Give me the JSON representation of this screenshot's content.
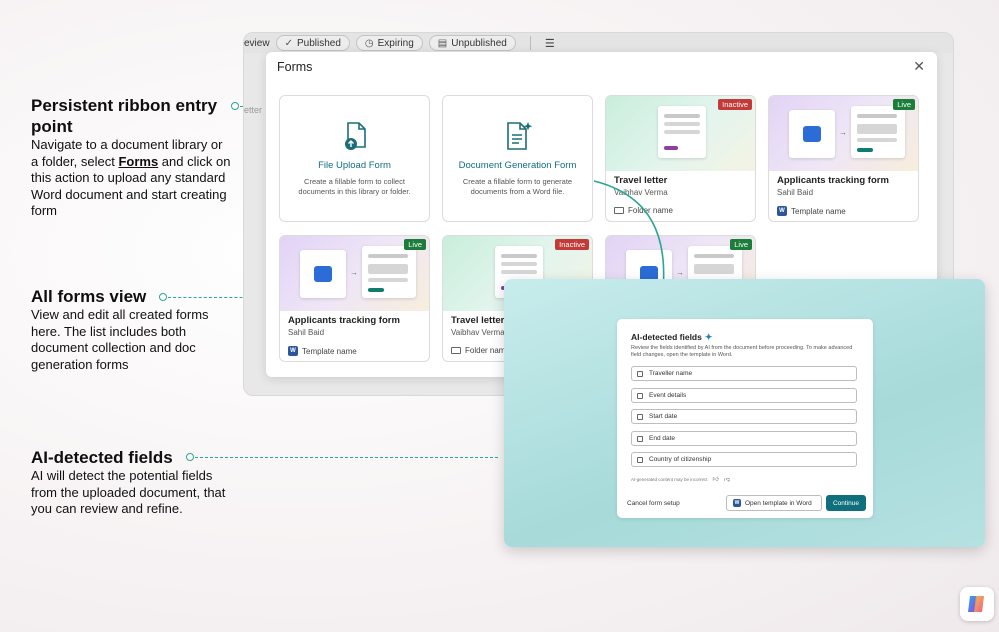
{
  "annotations": [
    {
      "title": "Persistent ribbon entry point",
      "body_before": "Navigate to a document library or a folder, select ",
      "body_bold": "Forms",
      "body_after": " and click on this action to upload any standard Word document and start creating form"
    },
    {
      "title": "All forms view",
      "body": "View and edit all created forms here. The list includes both document collection and doc generation forms"
    },
    {
      "title": "AI-detected fields",
      "body": "AI will detect the potential fields from the uploaded document, that you can review and refine."
    }
  ],
  "background_window": {
    "tabs": [
      {
        "label": "eview",
        "icon": ""
      },
      {
        "label": "Published",
        "icon": "check-circle-icon"
      },
      {
        "label": "Expiring",
        "icon": "clock-icon"
      },
      {
        "label": "Unpublished",
        "icon": "archive-icon"
      }
    ],
    "filter_icon": "filter-icon",
    "faint_text": "etter"
  },
  "forms_dialog": {
    "title": "Forms",
    "close_icon": "close-icon",
    "actions": [
      {
        "title": "File Upload Form",
        "description": "Create a fillable form to collect documents in this library or folder.",
        "icon": "file-upload-icon"
      },
      {
        "title": "Document Generation Form",
        "description": "Create a fillable form to generate documents from a Word file.",
        "icon": "doc-generation-icon"
      }
    ],
    "cards": [
      {
        "title": "Travel letter",
        "owner": "Vaibhav Verma",
        "footer": "Folder name",
        "status": "Inactive",
        "footer_icon": "folder-icon"
      },
      {
        "title": "Applicants tracking form",
        "owner": "Sahil Baid",
        "footer": "Template name",
        "status": "Live",
        "footer_icon": "word-icon"
      },
      {
        "title": "Applicants tracking form",
        "owner": "Sahil Baid",
        "footer": "Template name",
        "status": "Live",
        "footer_icon": "word-icon"
      },
      {
        "title": "Travel letter",
        "owner": "Vaibhav Verma",
        "footer": "Folder name",
        "status": "Inactive",
        "footer_icon": "folder-icon"
      },
      {
        "status": "Live"
      }
    ]
  },
  "ai_panel": {
    "title": "AI-detected fields",
    "description": "Review the fields identified by AI from the document before proceeding. To make advanced field changes, open the template in Word.",
    "fields": [
      "Traveller name",
      "Event details",
      "Start date",
      "End date",
      "Country of citizenship"
    ],
    "note": "AI-generated content may be incorrect",
    "cancel_label": "Cancel form setup",
    "open_word_label": "Open template in Word",
    "continue_label": "Continue"
  },
  "colors": {
    "accent": "#2aa596",
    "live": "#1c7c3a",
    "inactive": "#c33a38",
    "primary_button": "#0f6f7c"
  }
}
